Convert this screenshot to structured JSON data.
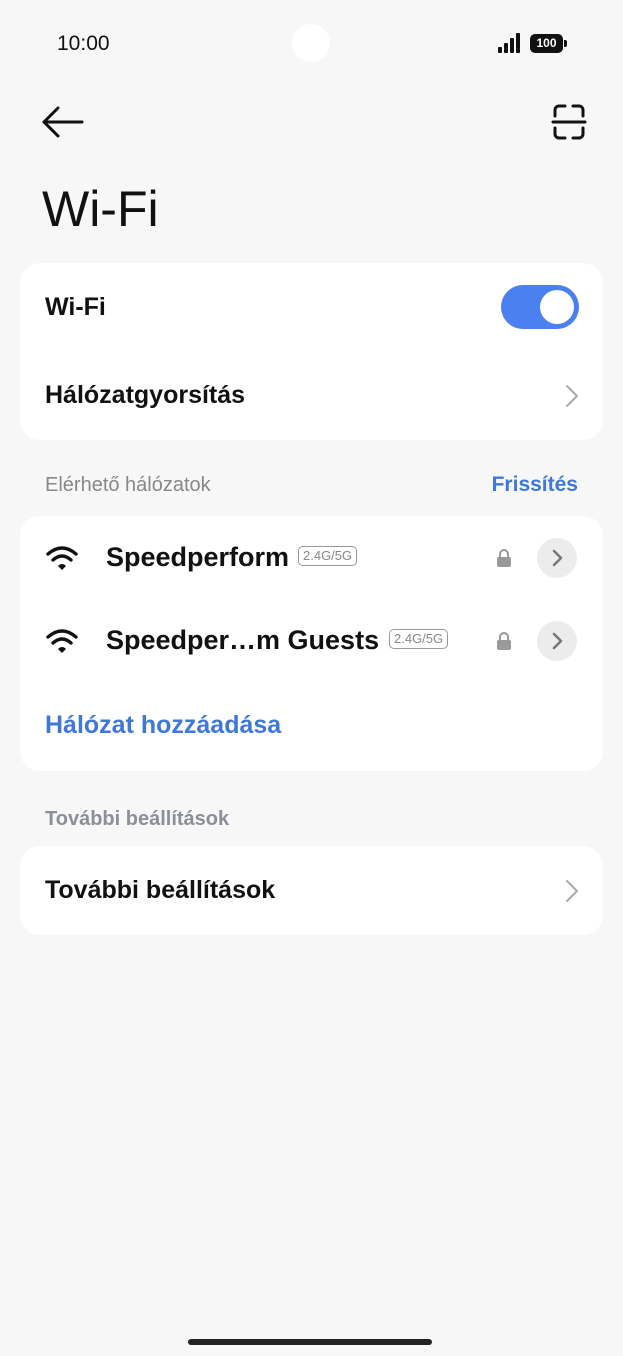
{
  "status_bar": {
    "time": "10:00",
    "battery_level": "100"
  },
  "header": {
    "title": "Wi-Fi"
  },
  "main_card": {
    "wifi_label": "Wi-Fi",
    "wifi_enabled": true,
    "acceleration_label": "Hálózatgyorsítás"
  },
  "available_networks": {
    "header": "Elérhető hálózatok",
    "refresh_label": "Frissítés",
    "networks": [
      {
        "name": "Speedperform",
        "band": "2.4G/5G",
        "secured": true
      },
      {
        "name": "Speedper…m Guests",
        "band": "2.4G/5G",
        "secured": true
      }
    ],
    "add_network_label": "Hálózat hozzáadása"
  },
  "more_settings": {
    "header": "További beállítások",
    "item_label": "További beállítások"
  },
  "colors": {
    "accent": "#3f78d8",
    "toggle_on": "#4a80f0",
    "background": "#f7f7f7",
    "card": "#ffffff"
  }
}
